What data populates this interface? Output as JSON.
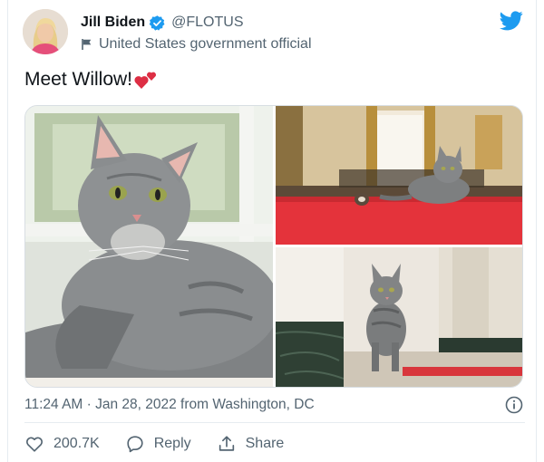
{
  "author": {
    "display_name": "Jill Biden",
    "handle": "@FLOTUS",
    "label": "United States government official",
    "avatar_icon": "avatar-photo",
    "verified_icon": "verified-badge-icon"
  },
  "tweet": {
    "text": "Meet Willow!",
    "emoji_icon": "two-hearts-icon",
    "media": [
      {
        "desc_icon": "cat-on-windowsill-photo"
      },
      {
        "desc_icon": "cat-on-red-carpet-photo"
      },
      {
        "desc_icon": "cat-walking-hallway-photo"
      }
    ]
  },
  "meta": {
    "timestamp": "11:24 AM · Jan 28, 2022 from Washington, DC"
  },
  "actions": {
    "like_count": "200.7K",
    "reply_label": "Reply",
    "share_label": "Share"
  },
  "colors": {
    "brand_blue": "#1d9bf0",
    "text_secondary": "#536471",
    "heart_red": "#e0245e"
  }
}
